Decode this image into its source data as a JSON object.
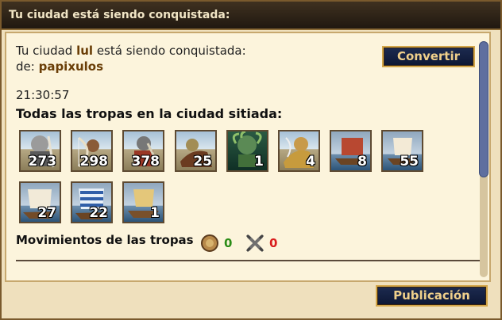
{
  "window": {
    "title": "Tu ciudad está siendo conquistada:"
  },
  "message": {
    "line1_before": "Tu ciudad ",
    "city": "lul",
    "line1_after": " está siendo conquistada:",
    "line2_label": "de: ",
    "attacker": "papixulos"
  },
  "actions": {
    "convert_label": "Convertir",
    "publish_label": "Publicación"
  },
  "timer": "21:30:57",
  "troops_heading": "Todas las tropas en la ciudad sitiada:",
  "units": [
    {
      "name": "hoplite",
      "count": "273"
    },
    {
      "name": "archer",
      "count": "298"
    },
    {
      "name": "swordsman",
      "count": "378"
    },
    {
      "name": "horseman",
      "count": "25"
    },
    {
      "name": "medusa",
      "count": "1"
    },
    {
      "name": "hero",
      "count": "4"
    },
    {
      "name": "transport-ship",
      "count": "8"
    },
    {
      "name": "light-ship",
      "count": "55"
    },
    {
      "name": "trireme",
      "count": "27"
    },
    {
      "name": "blue-trireme",
      "count": "22"
    },
    {
      "name": "sail-ship",
      "count": "1"
    }
  ],
  "movements": {
    "label": "Movimientos de las tropas",
    "support_icon": "shield-icon",
    "support_count": "0",
    "attack_icon": "crossed-swords-icon",
    "attack_count": "0"
  }
}
